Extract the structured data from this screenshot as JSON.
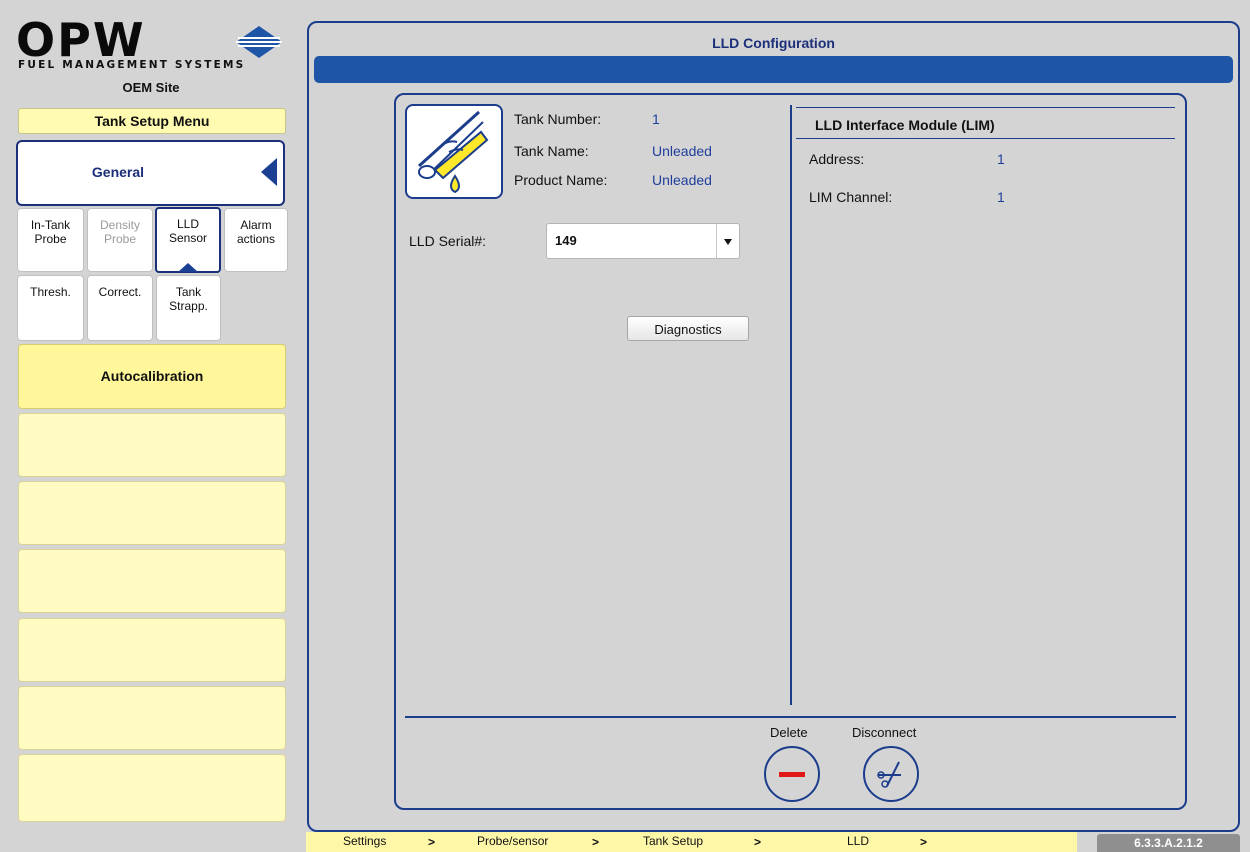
{
  "logo": {
    "text": "OPW",
    "subtitle": "FUEL MANAGEMENT SYSTEMS"
  },
  "site": {
    "name": "OEM Site"
  },
  "sidebar": {
    "menu_title": "Tank Setup Menu",
    "general_label": "General",
    "tabs": [
      {
        "line1": "In-Tank",
        "line2": "Probe",
        "state": "normal"
      },
      {
        "line1": "Density",
        "line2": "Probe",
        "state": "disabled"
      },
      {
        "line1": "LLD",
        "line2": "Sensor",
        "state": "selected"
      },
      {
        "line1": "Alarm",
        "line2": "actions",
        "state": "normal"
      },
      {
        "line1": "Thresh.",
        "line2": "",
        "state": "normal"
      },
      {
        "line1": "Correct.",
        "line2": "",
        "state": "normal"
      },
      {
        "line1": "Tank",
        "line2": "Strapp.",
        "state": "normal"
      }
    ],
    "autocalibration_label": "Autocalibration"
  },
  "main": {
    "title": "LLD Configuration",
    "tank_number_label": "Tank Number:",
    "tank_number": "1",
    "tank_name_label": "Tank Name:",
    "tank_name": "Unleaded",
    "product_name_label": "Product Name:",
    "product_name": "Unleaded",
    "serial_label": "LLD Serial#:",
    "serial_value": "149",
    "diagnostics_label": "Diagnostics",
    "lim": {
      "title": "LLD Interface Module (LIM)",
      "address_label": "Address:",
      "address": "1",
      "channel_label": "LIM Channel:",
      "channel": "1"
    },
    "delete_label": "Delete",
    "disconnect_label": "Disconnect"
  },
  "breadcrumb": {
    "items": [
      "Settings",
      "Probe/sensor",
      "Tank Setup",
      "LLD"
    ],
    "separator": ">"
  },
  "version": "6.3.3.A.2.1.2",
  "colors": {
    "accent_blue": "#1b3d8c",
    "title_bar": "#1f55a6",
    "menu_yellow": "#fff799",
    "delete_red": "#e01818"
  }
}
